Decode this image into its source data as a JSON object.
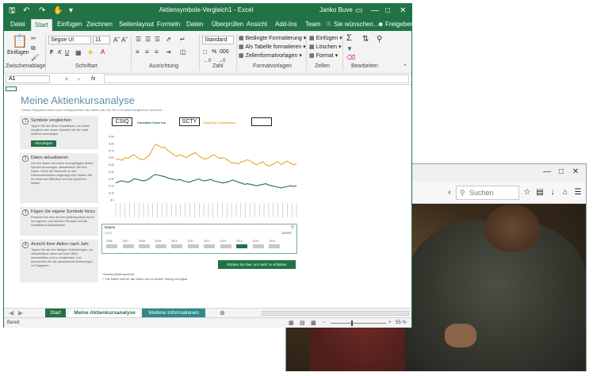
{
  "firefox": {
    "search_placeholder": "Suchen",
    "icons": [
      "reload-icon",
      "search-icon",
      "star-icon",
      "clipboard-icon",
      "download-icon",
      "home-icon",
      "shield-icon",
      "pocket-icon",
      "menu-icon"
    ]
  },
  "excel": {
    "title": "Aktiensymbole-Vergleich1 - Excel",
    "user": "Janko Buve",
    "tabs": [
      "Datei",
      "Start",
      "Einfügen",
      "Zeichnen",
      "Seitenlayout",
      "Formeln",
      "Daten",
      "Überprüfen",
      "Ansicht",
      "Add-Ins",
      "Team"
    ],
    "tell_me": "Sie wünschen...",
    "share": "Freigeben",
    "ribbon": {
      "paste": "Einfügen",
      "font_name": "Segoe UI",
      "font_size": "11",
      "number_format": "Standard",
      "cond_format": "Bedingte Formatierung",
      "as_table": "Als Tabelle formatieren",
      "cell_styles": "Zellenformatvorlagen",
      "insert": "Einfügen",
      "delete": "Löschen",
      "format": "Format",
      "groups": [
        "Zwischenablage",
        "Schriftart",
        "Ausrichtung",
        "Zahl",
        "Formatvorlagen",
        "Zellen",
        "Bearbeiten"
      ],
      "font_buttons": [
        "F",
        "K",
        "U"
      ],
      "percent": "%",
      "thousands": "000"
    },
    "formula_bar": {
      "name_box": "A1",
      "fx": "fx"
    },
    "sheet": {
      "title": "Meine Aktienkursanalyse",
      "subtitle": "Dieses Diagramm stellt neue Schlagzpreisen der Aktien dar, die Sie in Echtzeit vergleichen möchten.",
      "steps": [
        {
          "num": "1",
          "heading": "Symbole vergleichen",
          "text": "Tippen Sie auf diese Schaltfläche, um einen Vergleich des neuen Symbols mit den zwei anderen anzuzeigen.",
          "button": "Hinzufügen"
        },
        {
          "num": "2",
          "heading": "Daten aktualisieren",
          "text": "Um Ihre Daten mit einem hinzugefügten dritten Symbol anzuzeigen, aktualisieren Sie Ihre Daten. Wenn die Nachricht zu den Datenschutzstufen angezeigt wird, klicken Sie für beide auf Öffentlich und auf Speichern. Weiter."
        },
        {
          "num": "3",
          "heading": "Fügen Sie eigene Symbole hinzu",
          "text": "Ersetzen Sie eins der drei Aktiensymbole durch ein eigenes, und drücken Sie dann auf die Schaltfläche Aktualisieren."
        },
        {
          "num": "4",
          "heading": "Ansicht Ihrer Aktien nach Jahr",
          "text": "Tippen Sie auf den farbigen Schieberegler, um verschiedene Jahre auf einen Blick auszuwählen und zu vergleichen, und beobachten Sie die dynamischen Änderungen im Diagramm."
        }
      ],
      "symbols": [
        "CSIQ",
        "SCTY",
        ""
      ],
      "companies": [
        {
          "name": "Canadian Solar Inc.",
          "color": "#217346"
        },
        {
          "name": "SolarCity Corporation",
          "color": "#f0a030"
        }
      ],
      "timeline": {
        "title": "Datum",
        "subtitle": "2014",
        "mode": "JAHRE",
        "years": [
          "2006",
          "2007",
          "2008",
          "2009",
          "2010",
          "2011",
          "2012",
          "2013",
          "2014",
          "2015",
          "2016"
        ],
        "selected_year": "2014"
      },
      "learn_more": "Klicken Sie hier, um mehr zu erfahren",
      "notes": [
        "*Nasdaq-Aktiensymbole",
        "** Die Daten sind für alle Aktien bis zur letzten Teilung verfügbar"
      ]
    },
    "sheet_tabs": [
      "Start",
      "Meine Aktienkursanalyse",
      "Weitere Informationen"
    ],
    "status": {
      "ready": "Bereit",
      "zoom": "55 %"
    }
  },
  "chart_data": {
    "type": "line",
    "yticks": [
      "$ 90",
      "$ 80",
      "$ 70",
      "$ 60",
      "$ 50",
      "$ 40",
      "$ 30",
      "$ 20",
      "$ 10",
      "$ 0"
    ],
    "ylim": [
      0,
      90
    ],
    "series": [
      {
        "name": "SolarCity Corporation",
        "color": "#f0a030",
        "values": [
          57,
          58,
          56,
          60,
          59,
          62,
          64,
          60,
          58,
          57,
          60,
          63,
          72,
          79,
          77,
          74,
          75,
          70,
          67,
          64,
          62,
          64,
          62,
          60,
          63,
          65,
          67,
          63,
          60,
          58,
          59,
          62,
          64,
          61,
          59,
          60,
          58,
          55,
          52,
          53,
          51,
          54,
          55,
          57,
          55,
          52,
          50,
          52,
          54,
          50,
          48,
          50,
          52,
          54,
          50,
          53,
          55,
          52,
          50,
          51
        ]
      },
      {
        "name": "Canadian Solar Inc.",
        "color": "#217346",
        "values": [
          24,
          26,
          27,
          26,
          25,
          27,
          30,
          29,
          28,
          27,
          28,
          30,
          34,
          36,
          35,
          34,
          33,
          31,
          30,
          29,
          28,
          29,
          27,
          26,
          25,
          27,
          28,
          30,
          28,
          27,
          28,
          29,
          27,
          26,
          25,
          24,
          25,
          26,
          28,
          27,
          25,
          24,
          22,
          23,
          22,
          21,
          20,
          21,
          22,
          23,
          21,
          20,
          19,
          18,
          17,
          18,
          19,
          20,
          19,
          20
        ]
      }
    ],
    "x_tick_count": 40
  }
}
